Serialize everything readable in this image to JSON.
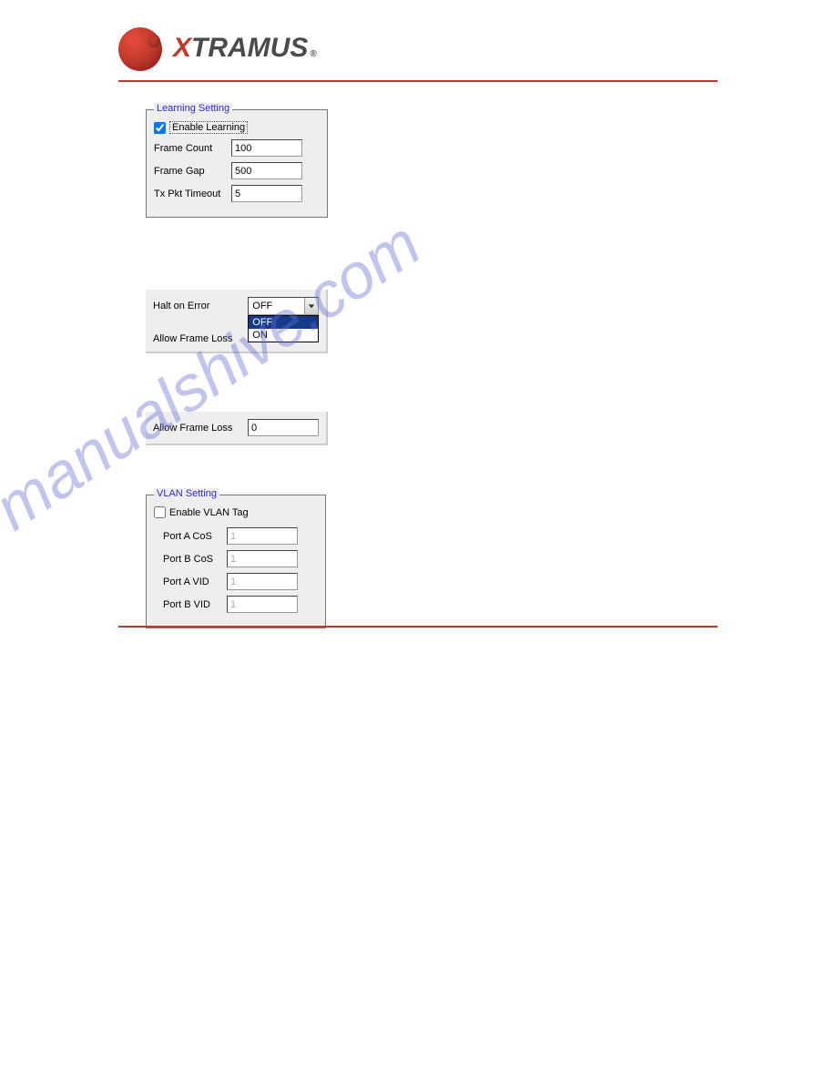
{
  "brand": {
    "x": "X",
    "rest": "TRAMUS",
    "reg": "®"
  },
  "watermark": "manualshive.com",
  "learning": {
    "title": "Learning Setting",
    "enable_label": "Enable Learning",
    "enable_checked": true,
    "frame_count_label": "Frame Count",
    "frame_count_value": "100",
    "frame_gap_label": "Frame Gap",
    "frame_gap_value": "500",
    "tx_timeout_label": "Tx Pkt Timeout",
    "tx_timeout_value": "5"
  },
  "halt": {
    "halt_label": "Halt on Error",
    "halt_selected": "OFF",
    "halt_options": [
      "OFF",
      "ON"
    ],
    "allow_label": "Allow Frame Loss"
  },
  "allow2": {
    "label": "Allow Frame Loss",
    "value": "0"
  },
  "vlan": {
    "title": "VLAN Setting",
    "enable_label": "Enable VLAN Tag",
    "enable_checked": false,
    "port_a_cos_label": "Port A CoS",
    "port_a_cos_value": "1",
    "port_b_cos_label": "Port B CoS",
    "port_b_cos_value": "1",
    "port_a_vid_label": "Port A VID",
    "port_a_vid_value": "1",
    "port_b_vid_label": "Port B VID",
    "port_b_vid_value": "1"
  }
}
